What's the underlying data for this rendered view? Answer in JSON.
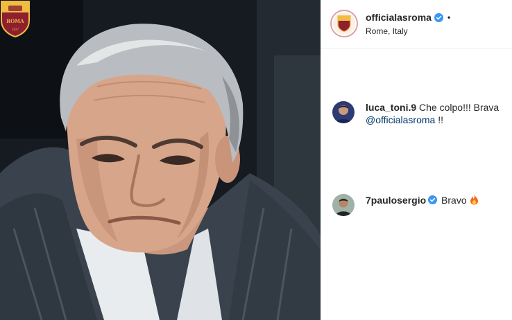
{
  "post": {
    "image_alt": "Portrait photo with AS Roma crest",
    "crest_text": "ROMA",
    "crest_year": "1927"
  },
  "header": {
    "username": "officialasroma",
    "verified": true,
    "dot": "•",
    "location": "Rome, Italy"
  },
  "comments": [
    {
      "username": "luca_toni.9",
      "verified": false,
      "text_before": " Che colpo!!! Brava ",
      "mention": "@officialasroma",
      "text_after": " !!"
    },
    {
      "username": "7paulosergio",
      "verified": true,
      "text_before": " Bravo ",
      "emoji": "fire-icon"
    }
  ],
  "colors": {
    "verified_blue": "#3897f0",
    "mention_blue": "#00376b",
    "roma_red": "#8e1f2f",
    "roma_gold": "#f0bc42"
  }
}
